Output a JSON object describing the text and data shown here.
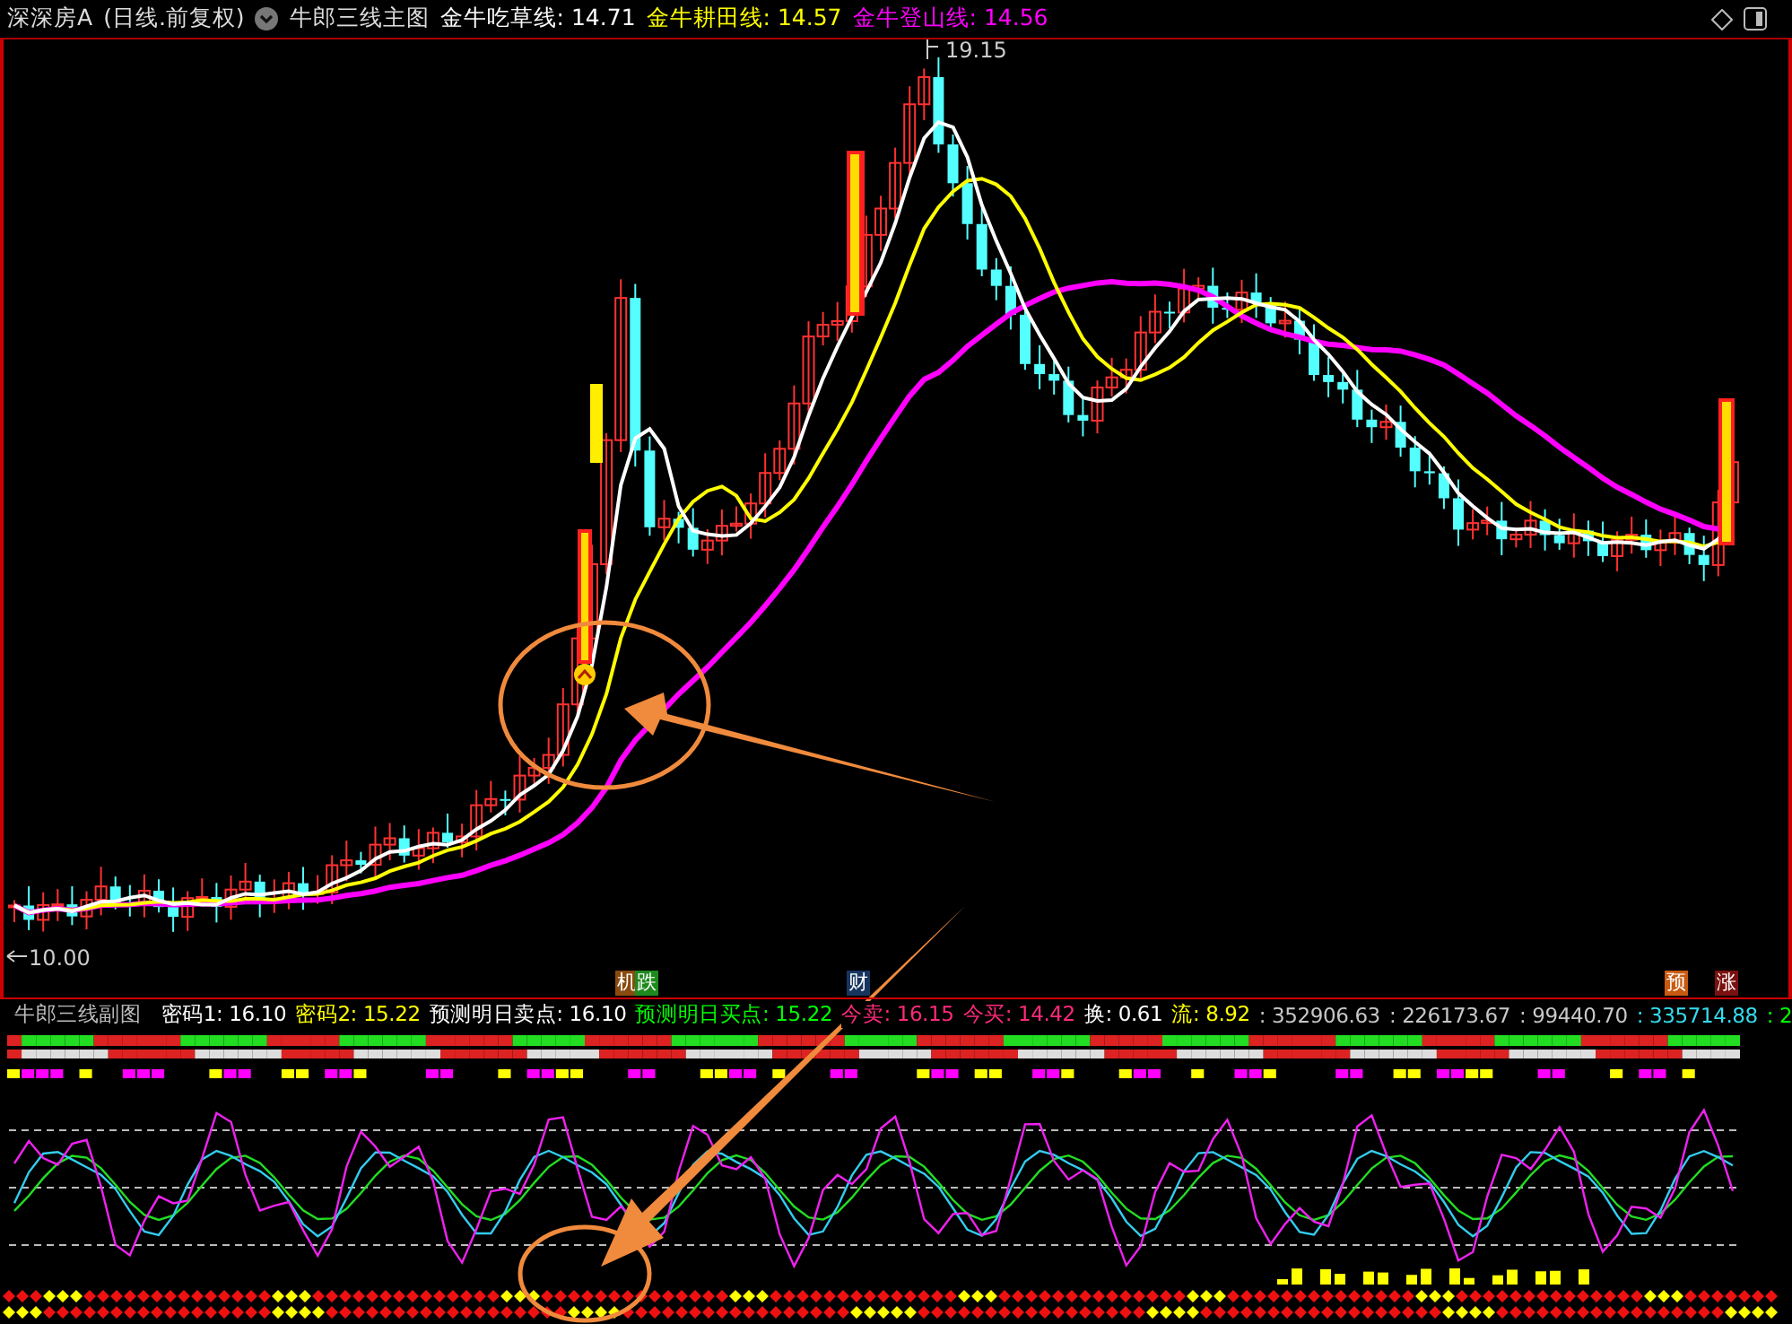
{
  "main_chart": {
    "stock_name": "深深房A",
    "adjust": "(日线.前复权)",
    "indicator": "牛郎三线主图",
    "lines": [
      {
        "text": "金牛吃草线: 14.71",
        "color": "#ffffff"
      },
      {
        "text": "金牛耕田线: 14.57",
        "color": "#ffff00"
      },
      {
        "text": "金牛登山线: 14.56",
        "color": "#ff00ff"
      }
    ],
    "high_label": "19.15",
    "low_label": "10.00"
  },
  "event_markers": [
    {
      "label": "机",
      "color": "#8a4a10"
    },
    {
      "label": "跌",
      "color": "#1e8a1e"
    },
    {
      "label": "财",
      "color": "#17365f"
    },
    {
      "label": "预",
      "color": "#c85a10"
    },
    {
      "label": "涨",
      "color": "#7a1010"
    }
  ],
  "sub_chart": {
    "indicator": "牛郎三线副图",
    "values": [
      {
        "text": "密码1: 16.10",
        "color": "#ffffff"
      },
      {
        "text": "密码2: 15.22",
        "color": "#ffff00"
      },
      {
        "text": "预测明日卖点: 16.10",
        "color": "#ffffff"
      },
      {
        "text": "预测明日买点: 15.22",
        "color": "#00ff00"
      },
      {
        "text": "今卖: 16.15",
        "color": "#ff2a7a"
      },
      {
        "text": "今买: 14.42",
        "color": "#ff2a7a"
      },
      {
        "text": "换: 0.61",
        "color": "#ffffff"
      },
      {
        "text": "流: 8.92",
        "color": "#ffff00"
      },
      {
        "text": ": 352906.63",
        "color": "#c8c8c8"
      },
      {
        "text": ": 226173.67",
        "color": "#c8c8c8"
      },
      {
        "text": ": 99440.70",
        "color": "#c8c8c8"
      },
      {
        "text": ": 335714.88",
        "color": "#33ddee"
      },
      {
        "text": ": 2",
        "color": "#00ff00"
      }
    ]
  }
}
